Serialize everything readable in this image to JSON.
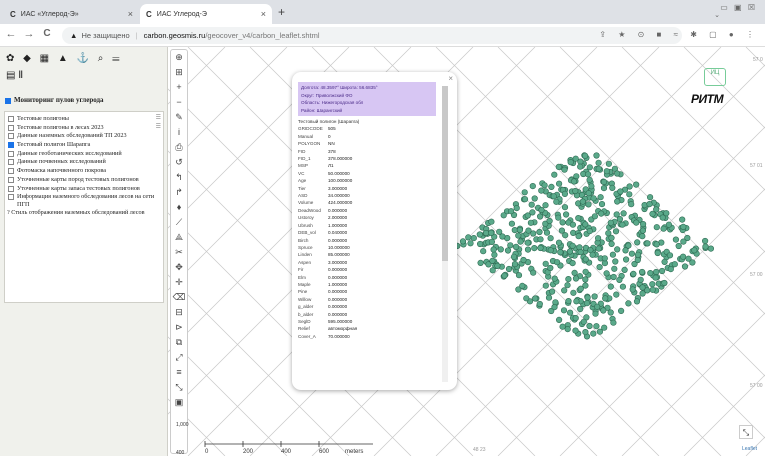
{
  "browser": {
    "tabs": [
      {
        "favicon": "C",
        "title": "ИАС «Углерод-Э»",
        "close": "×"
      },
      {
        "favicon": "C",
        "title": "ИАС Углерод-Э",
        "close": "×"
      }
    ],
    "new_tab": "+",
    "window_controls": "▭ ▣ ☒",
    "tab_chevron": "⌄",
    "nav": {
      "back": "←",
      "forward": "→",
      "reload": "C"
    },
    "address": {
      "warning_icon": "▲",
      "not_secure": "Не защищено",
      "separator": "|",
      "host": "carbon.geosmis.ru",
      "path": "/geocover_v4/carbon_leaflet.shtml"
    },
    "toolbar_icons": "⇪ ★ ⊙ ■ ≈ ✱ ▢ ● ⋮"
  },
  "sidebar": {
    "tool_icons": "✿ ◆ ▦ ▲ ⚓ ⌕ ☰",
    "tool_icons_row2": "▤ Ⅱ",
    "main_layer": "Мониторинг пулов углерода",
    "layers": [
      {
        "label": "Тестовые полигоны",
        "checked": false,
        "extra": "☰"
      },
      {
        "label": "Тестовые полигоны в лесах 2023",
        "checked": false,
        "extra": "☰"
      },
      {
        "label": "Данные наземных обследований ТП 2023",
        "checked": false,
        "extra": ""
      },
      {
        "label": "Тестовый полигон Шарапга",
        "checked": true,
        "extra": ""
      },
      {
        "label": "Данные геоботанических исследований",
        "checked": false,
        "extra": ""
      },
      {
        "label": "Данные почвенных исследований",
        "checked": false,
        "extra": ""
      },
      {
        "label": "Фотомаска напочвенного покрова",
        "checked": false,
        "extra": ""
      },
      {
        "label": "Уточненные карты пород тестовых полигонов",
        "checked": false,
        "extra": ""
      },
      {
        "label": "Уточненные карты запаса тестовых полигонов",
        "checked": false,
        "extra": ""
      },
      {
        "label": "Информация наземного обследования лесов на сети ПГП",
        "checked": false,
        "extra": ""
      }
    ],
    "style_note": "? Стиль отображения наземных обследований лесов"
  },
  "map": {
    "tools": [
      "⊕",
      "⊞",
      "+",
      "−",
      "✎",
      "i",
      "⎙",
      "↺",
      "↰",
      "↱",
      "♦",
      "⟋",
      "⟁",
      "✂",
      "✥",
      "✛",
      "⌫",
      "⊟",
      "⊳",
      "⧉",
      "⤢",
      "≡",
      "⤡",
      "▣"
    ],
    "scale_left": {
      "top": "1,000",
      "mid": "400",
      "bottom": "0"
    },
    "scale": {
      "ticks": [
        "0",
        "200",
        "400",
        "600"
      ],
      "unit": "meters"
    },
    "right_labels": [
      "57 0",
      "57 01",
      "57 00",
      "57 00"
    ],
    "bottom_label": "48 23",
    "logo_text": "ИЦ",
    "brand": "РИТМ",
    "expand_icon": "⤡",
    "attribution": "Leaflet"
  },
  "popup": {
    "close": "×",
    "header": [
      "Долгота: 48.3597°    Широта: 56.6835°",
      "Округ: Приволжский ФО",
      "Область: Нижегородская обл",
      "Район: Шарангский"
    ],
    "title": "Тестовый полигон (Шарапга)",
    "rows": [
      [
        "GRIDCODE",
        "505"
      ],
      [
        "Manual",
        "0"
      ],
      [
        "POLYGON",
        "NN"
      ],
      [
        "FID",
        "378"
      ],
      [
        "FID_1",
        "378.000000"
      ],
      [
        "MSP",
        "Л1"
      ],
      [
        "VC",
        "50.000000"
      ],
      [
        "Age",
        "100.000000"
      ],
      [
        "Tier",
        "3.000000"
      ],
      [
        "ASD",
        "34.000000"
      ],
      [
        "Volume",
        "424.000000"
      ],
      [
        "DeadWood",
        "0.000000"
      ],
      [
        "Ustoroy",
        "2.000000"
      ],
      [
        "Ubrush",
        "1.000000"
      ],
      [
        "DEB_vol",
        "0.040000"
      ],
      [
        "Birch",
        "0.000000"
      ],
      [
        "Spruce",
        "10.000000"
      ],
      [
        "Linden",
        "85.000000"
      ],
      [
        "Aspen",
        "3.000000"
      ],
      [
        "Fir",
        "0.000000"
      ],
      [
        "Elm",
        "0.000000"
      ],
      [
        "Maple",
        "1.000000"
      ],
      [
        "Pine",
        "0.000000"
      ],
      [
        "Willow",
        "0.000000"
      ],
      [
        "g_alder",
        "0.000000"
      ],
      [
        "b_alder",
        "0.000000"
      ],
      [
        "SeglD",
        "595.000000"
      ],
      [
        "Relief",
        "автоморфная"
      ],
      [
        "Cover_A",
        "70.000000"
      ]
    ]
  },
  "points_count": 520,
  "colors": {
    "point_fill": "#5aa98a",
    "point_stroke": "#2e6a52",
    "popup_header": "#d7c6f3"
  }
}
